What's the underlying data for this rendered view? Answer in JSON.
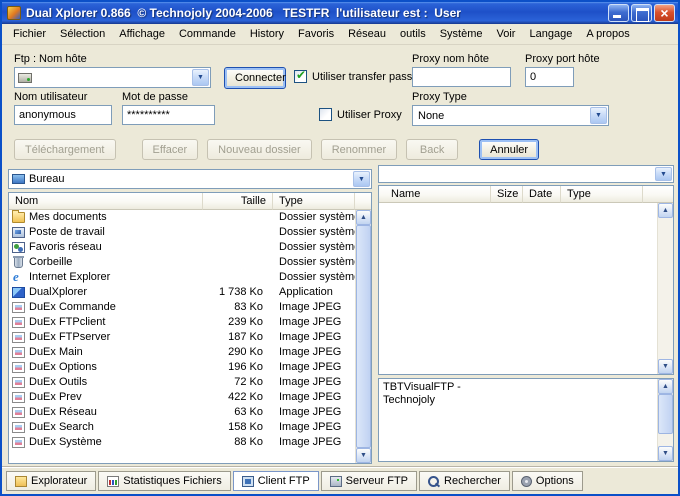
{
  "window": {
    "title": "Dual Xplorer 0.866  © Technojoly 2004-2006   TESTFR  l'utilisateur est :  User"
  },
  "menu": {
    "items": [
      "Fichier",
      "Sélection",
      "Affichage",
      "Commande",
      "History",
      "Favoris",
      "Réseau",
      "outils",
      "Système",
      "Voir",
      "Langage",
      "A propos"
    ]
  },
  "ftp_form": {
    "host_label": "Ftp : Nom hôte",
    "host_value": "",
    "connect_button": "Connecter",
    "passive_checkbox_label": "Utiliser transfer passif",
    "proxy_host_label": "Proxy nom hôte",
    "proxy_host_value": "",
    "proxy_port_label": "Proxy port hôte",
    "proxy_port_value": "0",
    "username_label": "Nom utilisateur",
    "username_value": "anonymous",
    "password_label": "Mot de passe",
    "password_value": "**********",
    "use_proxy_checkbox_label": "Utiliser Proxy",
    "proxy_type_label": "Proxy Type",
    "proxy_type_value": "None"
  },
  "toolbar": {
    "buttons": [
      {
        "label": "Téléchargement",
        "enabled": false
      },
      {
        "label": "Effacer",
        "enabled": false
      },
      {
        "label": "Nouveau dossier",
        "enabled": false
      },
      {
        "label": "Renommer",
        "enabled": false
      },
      {
        "label": "Back",
        "enabled": false
      },
      {
        "label": "Annuler",
        "enabled": true,
        "focused": true
      }
    ]
  },
  "local_panel": {
    "path_value": "Bureau",
    "columns": [
      "Nom",
      "Taille",
      "Type"
    ],
    "rows": [
      {
        "icon": "folder-documents",
        "name": "Mes documents",
        "size": "",
        "type": "Dossier système"
      },
      {
        "icon": "my-computer",
        "name": "Poste de travail",
        "size": "",
        "type": "Dossier système"
      },
      {
        "icon": "network",
        "name": "Favoris réseau",
        "size": "",
        "type": "Dossier système"
      },
      {
        "icon": "recycle-bin",
        "name": "Corbeille",
        "size": "",
        "type": "Dossier système"
      },
      {
        "icon": "internet-explorer",
        "name": "Internet Explorer",
        "size": "",
        "type": "Dossier système"
      },
      {
        "icon": "application",
        "name": "DualXplorer",
        "size": "1 738 Ko",
        "type": "Application"
      },
      {
        "icon": "image",
        "name": "DuEx Commande",
        "size": "83 Ko",
        "type": "Image JPEG"
      },
      {
        "icon": "image",
        "name": "DuEx FTPclient",
        "size": "239 Ko",
        "type": "Image JPEG"
      },
      {
        "icon": "image",
        "name": "DuEx FTPserver",
        "size": "187 Ko",
        "type": "Image JPEG"
      },
      {
        "icon": "image",
        "name": "DuEx Main",
        "size": "290 Ko",
        "type": "Image JPEG"
      },
      {
        "icon": "image",
        "name": "DuEx Options",
        "size": "196 Ko",
        "type": "Image JPEG"
      },
      {
        "icon": "image",
        "name": "DuEx Outils",
        "size": "72 Ko",
        "type": "Image JPEG"
      },
      {
        "icon": "image",
        "name": "DuEx Prev",
        "size": "422 Ko",
        "type": "Image JPEG"
      },
      {
        "icon": "image",
        "name": "DuEx Réseau",
        "size": "63 Ko",
        "type": "Image JPEG"
      },
      {
        "icon": "image",
        "name": "DuEx Search",
        "size": "158 Ko",
        "type": "Image JPEG"
      },
      {
        "icon": "image",
        "name": "DuEx Système",
        "size": "88 Ko",
        "type": "Image JPEG"
      }
    ]
  },
  "remote_panel": {
    "path_value": "",
    "columns": [
      "Name",
      "Size",
      "Date",
      "Type"
    ],
    "rows": [],
    "log_text": "TBTVisualFTP  -\nTechnojoly"
  },
  "tabs": [
    {
      "icon": "explorer",
      "label": "Explorateur",
      "active": false
    },
    {
      "icon": "stats",
      "label": "Statistiques Fichiers",
      "active": false
    },
    {
      "icon": "client-ftp",
      "label": "Client FTP",
      "active": true
    },
    {
      "icon": "server-ftp",
      "label": "Serveur FTP",
      "active": false
    },
    {
      "icon": "search",
      "label": "Rechercher",
      "active": false
    },
    {
      "icon": "options",
      "label": "Options",
      "active": false
    }
  ]
}
